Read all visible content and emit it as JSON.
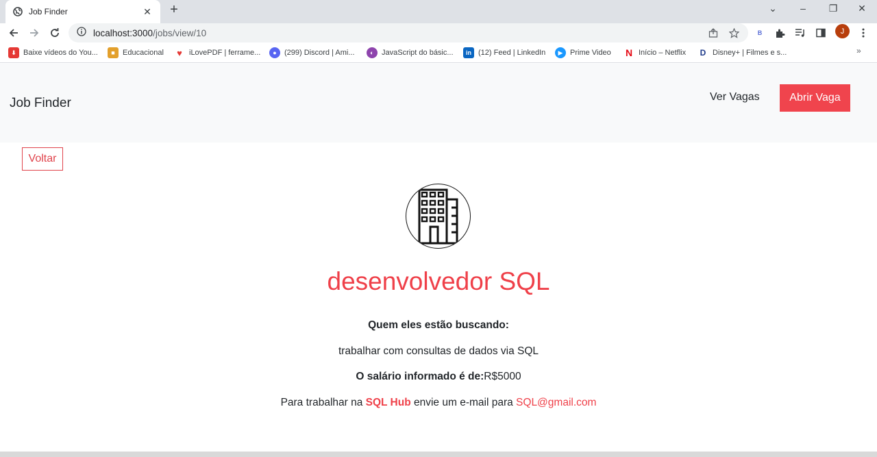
{
  "browser": {
    "tab": {
      "title": "Job Finder",
      "close": "✕"
    },
    "new_tab": "+",
    "window_controls": [
      "⌄",
      "–",
      "❐",
      "✕"
    ],
    "address": {
      "host": "localhost:3000",
      "path": "/jobs/view/10"
    },
    "profile_initial": "J",
    "bookmarks": [
      {
        "label": "Baixe vídeos do You...",
        "icon": "download-icon",
        "color": "#e53935"
      },
      {
        "label": "Educacional",
        "icon": "folder-icon",
        "color": "#f4b400"
      },
      {
        "label": "iLovePDF | ferrame...",
        "icon": "heart-icon",
        "color": "#e53935"
      },
      {
        "label": "(299) Discord | Ami...",
        "icon": "discord-icon",
        "color": "#5865f2"
      },
      {
        "label": "JavaScript do básic...",
        "icon": "js-icon",
        "color": "#8e44ad"
      },
      {
        "label": "(12) Feed | LinkedIn",
        "icon": "linkedin-icon",
        "color": "#0a66c2"
      },
      {
        "label": "Prime Video",
        "icon": "play-icon",
        "color": "#1a98ff"
      },
      {
        "label": "Início – Netflix",
        "icon": "netflix-icon",
        "color": "#e50914"
      },
      {
        "label": "Disney+ | Filmes e s...",
        "icon": "disney-icon",
        "color": "#1e3a8a"
      }
    ],
    "bookmarks_more": "»"
  },
  "header": {
    "brand": "Job Finder",
    "nav_link": "Ver Vagas",
    "cta": "Abrir Vaga"
  },
  "back_button": "Voltar",
  "job": {
    "title": "desenvolvedor SQL",
    "seeking_label": "Quem eles estão buscando:",
    "description": "trabalhar com consultas de dados via SQL",
    "salary_label": "O salário informado é de:",
    "salary": "R$5000",
    "contact_prefix": "Para trabalhar na",
    "company": "SQL Hub",
    "contact_middle": "envie um e-mail para",
    "email": "SQL@gmail.com"
  },
  "colors": {
    "accent": "#ef4049",
    "header_bg": "#f8f9fa"
  }
}
